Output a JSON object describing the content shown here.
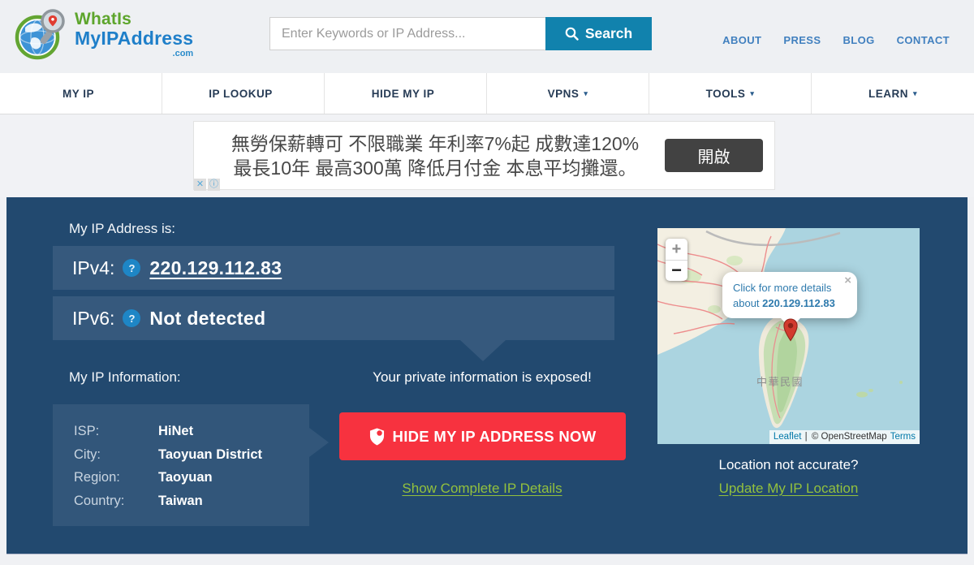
{
  "colors": {
    "accent_blue": "#1182ad",
    "link_blue": "#4180bf",
    "nav_text": "#263b55",
    "panel_bg": "#22496f",
    "row_bg": "#36597d",
    "help_circle": "#1e86c6",
    "alert_red": "#f7323f",
    "link_green": "#93c13d",
    "map_sea": "#abd4e0",
    "attribution_link": "#0078a8"
  },
  "header": {
    "logo": {
      "line1": "WhatIs",
      "line2": "MyIPAddress",
      "tld": ".com"
    },
    "search": {
      "placeholder": "Enter Keywords or IP Address...",
      "button_label": "Search"
    },
    "links": [
      "ABOUT",
      "PRESS",
      "BLOG",
      "CONTACT"
    ]
  },
  "nav": {
    "items": [
      {
        "label": "MY IP",
        "caret": ""
      },
      {
        "label": "IP LOOKUP",
        "caret": ""
      },
      {
        "label": "HIDE MY IP",
        "caret": ""
      },
      {
        "label": "VPNS",
        "caret": "▾"
      },
      {
        "label": "TOOLS",
        "caret": "▾"
      },
      {
        "label": "LEARN",
        "caret": "▾"
      }
    ]
  },
  "ad": {
    "line1": "無勞保薪轉可 不限職業 年利率7%起 成數達120%",
    "line2": "最長10年 最高300萬 降低月付金 本息平均攤還。",
    "button_label": "開啟",
    "close_glyph": "✕",
    "info_glyph": "ⓘ"
  },
  "main": {
    "ip_heading": "My IP Address is:",
    "ipv4_label": "IPv4:",
    "ipv4_value": "220.129.112.83",
    "ipv6_label": "IPv6:",
    "ipv6_value": "Not detected",
    "help_glyph": "?",
    "info_heading": "My IP Information:",
    "exposed_text": "Your private information is exposed!",
    "info_rows": [
      {
        "label": "ISP:",
        "value": "HiNet"
      },
      {
        "label": "City:",
        "value": "Taoyuan District"
      },
      {
        "label": "Region:",
        "value": "Taoyuan"
      },
      {
        "label": "Country:",
        "value": "Taiwan"
      }
    ],
    "hide_button_label": "HIDE MY IP ADDRESS NOW",
    "details_link": "Show Complete IP Details",
    "location_question": "Location not accurate?",
    "location_link": "Update My IP Location"
  },
  "map": {
    "zoom_in": "+",
    "zoom_out": "−",
    "popup": {
      "line1": "Click for more details",
      "line2_prefix": "about",
      "ip": "220.129.112.83",
      "close_glyph": "×"
    },
    "island_label": "中華民國",
    "attribution": {
      "leaflet": "Leaflet",
      "separator": "|",
      "osm": "© OpenStreetMap",
      "terms": "Terms"
    }
  }
}
